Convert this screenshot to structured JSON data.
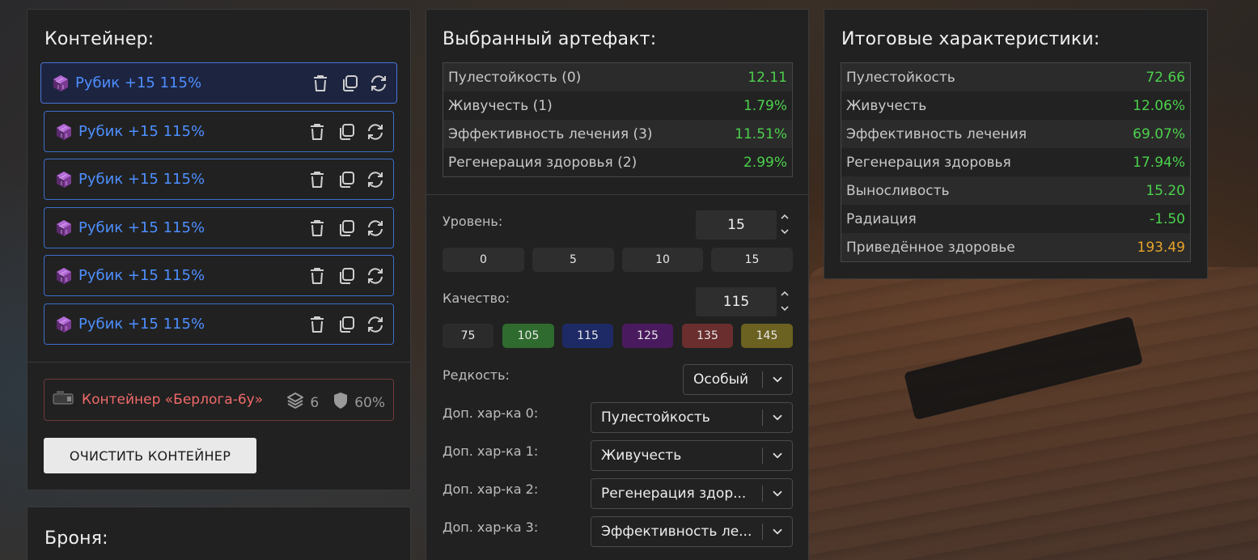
{
  "container_panel": {
    "title": "Контейнер:",
    "artifacts": [
      {
        "name": "Рубик +15 115%"
      },
      {
        "name": "Рубик +15 115%"
      },
      {
        "name": "Рубик +15 115%"
      },
      {
        "name": "Рубик +15 115%"
      },
      {
        "name": "Рубик +15 115%"
      },
      {
        "name": "Рубик +15 115%"
      }
    ],
    "container": {
      "name": "Контейнер «Берлога-6у»",
      "slots": "6",
      "protection": "60%"
    },
    "clear_button": "ОЧИСТИТЬ КОНТЕЙНЕР"
  },
  "armor_panel": {
    "title": "Броня:"
  },
  "selected_panel": {
    "title": "Выбранный артефакт:",
    "stats": [
      {
        "label": "Пулестойкость (0)",
        "value": "12.11"
      },
      {
        "label": "Живучесть (1)",
        "value": "1.79%"
      },
      {
        "label": "Эффективность лечения (3)",
        "value": "11.51%"
      },
      {
        "label": "Регенерация здоровья (2)",
        "value": "2.99%"
      }
    ],
    "level": {
      "label": "Уровень:",
      "value": "15",
      "presets": [
        "0",
        "5",
        "10",
        "15"
      ]
    },
    "quality": {
      "label": "Качество:",
      "value": "115",
      "presets": [
        {
          "label": "75",
          "color": "#2b2b2b"
        },
        {
          "label": "105",
          "color": "#2f6b2f"
        },
        {
          "label": "115",
          "color": "#1e2a66"
        },
        {
          "label": "125",
          "color": "#4a1a5e"
        },
        {
          "label": "135",
          "color": "#6a2e2e"
        },
        {
          "label": "145",
          "color": "#6b6120"
        }
      ]
    },
    "rarity": {
      "label": "Редкость:",
      "value": "Особый"
    },
    "extra": [
      {
        "label": "Доп. хар-ка 0:",
        "value": "Пулестойкость"
      },
      {
        "label": "Доп. хар-ка 1:",
        "value": "Живучесть"
      },
      {
        "label": "Доп. хар-ка 2:",
        "value": "Регенерация здор..."
      },
      {
        "label": "Доп. хар-ка 3:",
        "value": "Эффективность ле..."
      }
    ]
  },
  "totals_panel": {
    "title": "Итоговые характеристики:",
    "stats": [
      {
        "label": "Пулестойкость",
        "value": "72.66",
        "tone": "green"
      },
      {
        "label": "Живучесть",
        "value": "12.06%",
        "tone": "green"
      },
      {
        "label": "Эффективность лечения",
        "value": "69.07%",
        "tone": "green"
      },
      {
        "label": "Регенерация здоровья",
        "value": "17.94%",
        "tone": "green"
      },
      {
        "label": "Выносливость",
        "value": "15.20",
        "tone": "green"
      },
      {
        "label": "Радиация",
        "value": "-1.50",
        "tone": "green"
      },
      {
        "label": "Приведённое здоровье",
        "value": "193.49",
        "tone": "orange"
      }
    ]
  },
  "colors": {
    "green": "#4cd14c",
    "orange": "#e6a42a",
    "artifact_blue": "#4d8fff",
    "container_red": "#f06a6a"
  }
}
